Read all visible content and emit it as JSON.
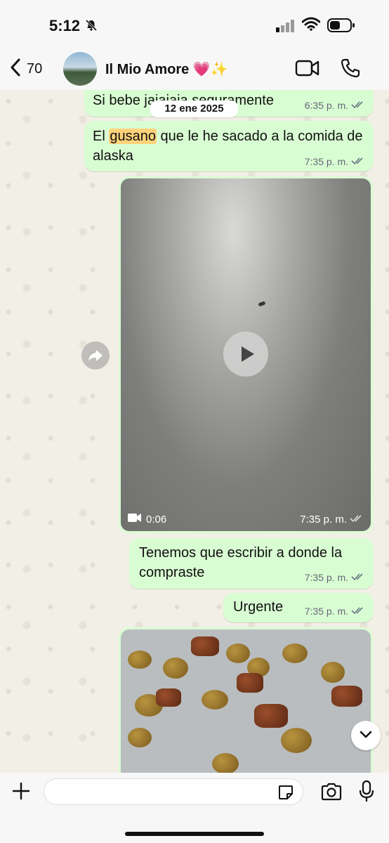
{
  "status_bar": {
    "time": "5:12"
  },
  "header": {
    "back_count": "70",
    "contact_name": "Il Mio Amore 💗✨"
  },
  "date_chip": "12 ene 2025",
  "messages": [
    {
      "text": "Si bebe jajajaja seguramente",
      "time": "6:35 p. m."
    },
    {
      "text_before": "El ",
      "highlight": "gusano",
      "text_after": " que le he sacado a la comida de alaska",
      "time": "7:35 p. m."
    },
    {
      "type": "video",
      "duration": "0:06",
      "time": "7:35 p. m."
    },
    {
      "text": "Tenemos que escribir a donde la compraste",
      "time": "7:35 p. m."
    },
    {
      "text": "Urgente",
      "time": "7:35 p. m."
    }
  ],
  "composer": {
    "placeholder": ""
  },
  "colors": {
    "bubble": "#d9fdd3",
    "highlight": "#ffd27a",
    "ticks": "#667781"
  }
}
